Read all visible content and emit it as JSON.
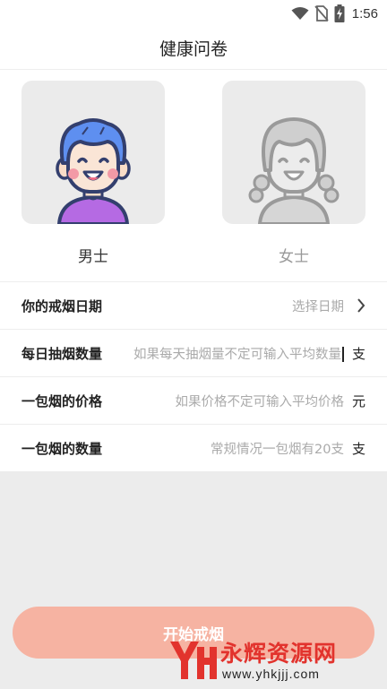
{
  "status_bar": {
    "time": "1:56",
    "icons": [
      "wifi-icon",
      "no-sim-icon",
      "battery-charging-icon"
    ]
  },
  "header": {
    "title": "健康问卷"
  },
  "gender": {
    "male": {
      "label": "男士",
      "selected": true
    },
    "female": {
      "label": "女士",
      "selected": false
    }
  },
  "form": {
    "quit_date": {
      "label": "你的戒烟日期",
      "value": "选择日期",
      "icon": "chevron-right-icon"
    },
    "daily_count": {
      "label": "每日抽烟数量",
      "placeholder": "如果每天抽烟量不定可输入平均数量",
      "unit": "支"
    },
    "pack_price": {
      "label": "一包烟的价格",
      "placeholder": "如果价格不定可输入平均价格",
      "unit": "元"
    },
    "pack_count": {
      "label": "一包烟的数量",
      "placeholder": "常规情况一包烟有20支",
      "unit": "支"
    }
  },
  "start_button": {
    "label": "开始戒烟"
  },
  "watermark": {
    "name": "永辉资源网",
    "url": "www.yhkjjj.com"
  },
  "colors": {
    "accent": "#f6b3a2",
    "watermark_red": "#e2332d"
  }
}
